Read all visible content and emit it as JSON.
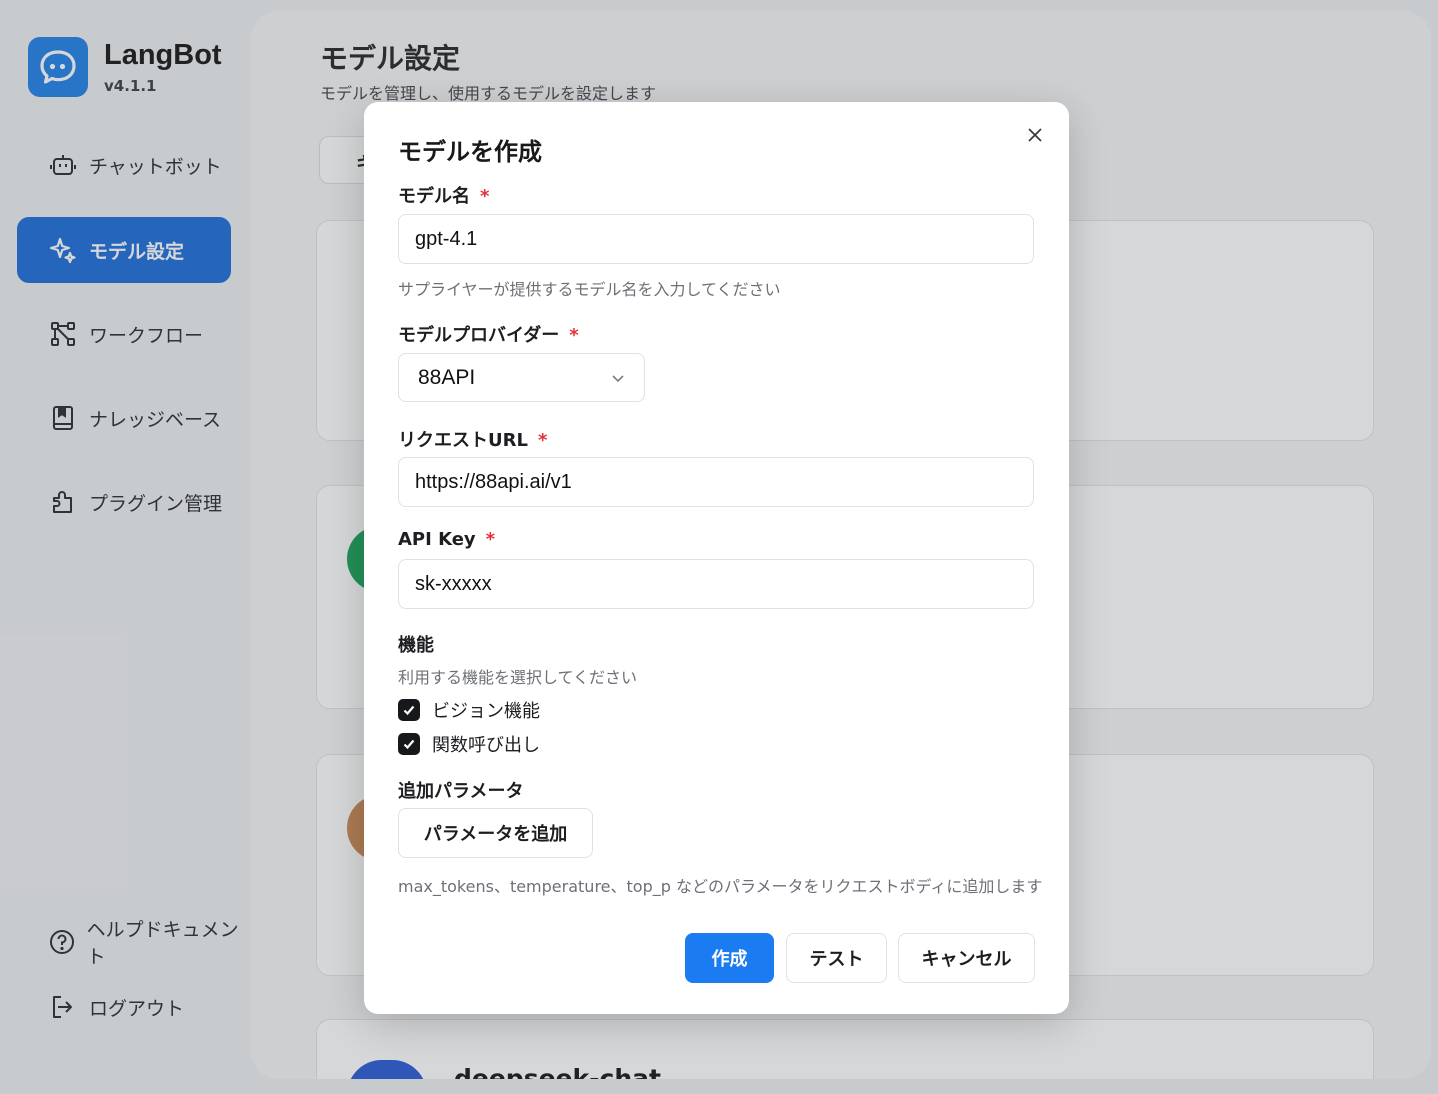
{
  "brand": {
    "name": "LangBot",
    "version": "v4.1.1",
    "logo_icon": "chat-bubble-icon",
    "accent": "#2080ea"
  },
  "sidebar": {
    "items": [
      {
        "label": "チャットボット",
        "icon": "robot-icon",
        "active": false
      },
      {
        "label": "モデル設定",
        "icon": "sparkle-icon",
        "active": true
      },
      {
        "label": "ワークフロー",
        "icon": "workflow-icon",
        "active": false
      },
      {
        "label": "ナレッジベース",
        "icon": "book-icon",
        "active": false
      },
      {
        "label": "プラグイン管理",
        "icon": "puzzle-icon",
        "active": false
      }
    ],
    "bottom": [
      {
        "label": "ヘルプドキュメント",
        "icon": "help-circle-icon"
      },
      {
        "label": "ログアウト",
        "icon": "logout-icon"
      }
    ]
  },
  "main": {
    "title": "モデル設定",
    "subtitle": "モデルを管理し、使用するモデルを設定します",
    "tab_partial": "キ",
    "cards": [
      {
        "title": ""
      },
      {
        "title": "",
        "avatar_color": "#1aa35a"
      },
      {
        "title": "",
        "avatar_color": "#c98a55"
      },
      {
        "title": "deepseek-chat",
        "avatar_color": "#2a5bd7"
      }
    ]
  },
  "dialog": {
    "title": "モデルを作成",
    "model_name": {
      "label": "モデル名",
      "required_mark": "*",
      "value": "gpt-4.1",
      "help": "サプライヤーが提供するモデル名を入力してください"
    },
    "provider": {
      "label": "モデルプロバイダー",
      "required_mark": "*",
      "selected": "88API"
    },
    "request_url": {
      "label": "リクエストURL",
      "required_mark": "*",
      "value": "https://88api.ai/v1"
    },
    "api_key": {
      "label": "API Key",
      "required_mark": "*",
      "value": "sk-xxxxx"
    },
    "abilities": {
      "label": "機能",
      "help": "利用する機能を選択してください",
      "options": [
        {
          "label": "ビジョン機能",
          "checked": true
        },
        {
          "label": "関数呼び出し",
          "checked": true
        }
      ]
    },
    "extra_params": {
      "label": "追加パラメータ",
      "button_label": "パラメータを追加",
      "help": "max_tokens、temperature、top_p などのパラメータをリクエストボディに追加します"
    },
    "buttons": {
      "create": "作成",
      "test": "テスト",
      "cancel": "キャンセル"
    },
    "primary_color": "#1a7cf0",
    "required_color": "#e5303a"
  }
}
